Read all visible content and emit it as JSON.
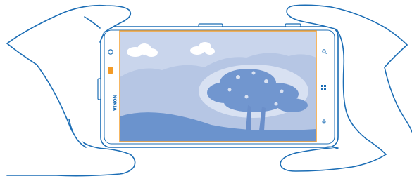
{
  "device": {
    "brand": "NOKIA",
    "orientation": "landscape"
  },
  "colors": {
    "outline": "#1b6db5",
    "sky": "#c7d3ea",
    "sky_light": "#d6dff0",
    "hill": "#6b93cd",
    "tree": "#6f94ce",
    "screen_frame": "#f3a43a",
    "camera_key": "#f39b27"
  },
  "icons": {
    "left_top": "front-camera-icon",
    "left_middle": "camera-key-icon",
    "right_top": "search-icon",
    "right_middle": "windows-start-icon",
    "right_bottom": "back-arrow-icon"
  }
}
